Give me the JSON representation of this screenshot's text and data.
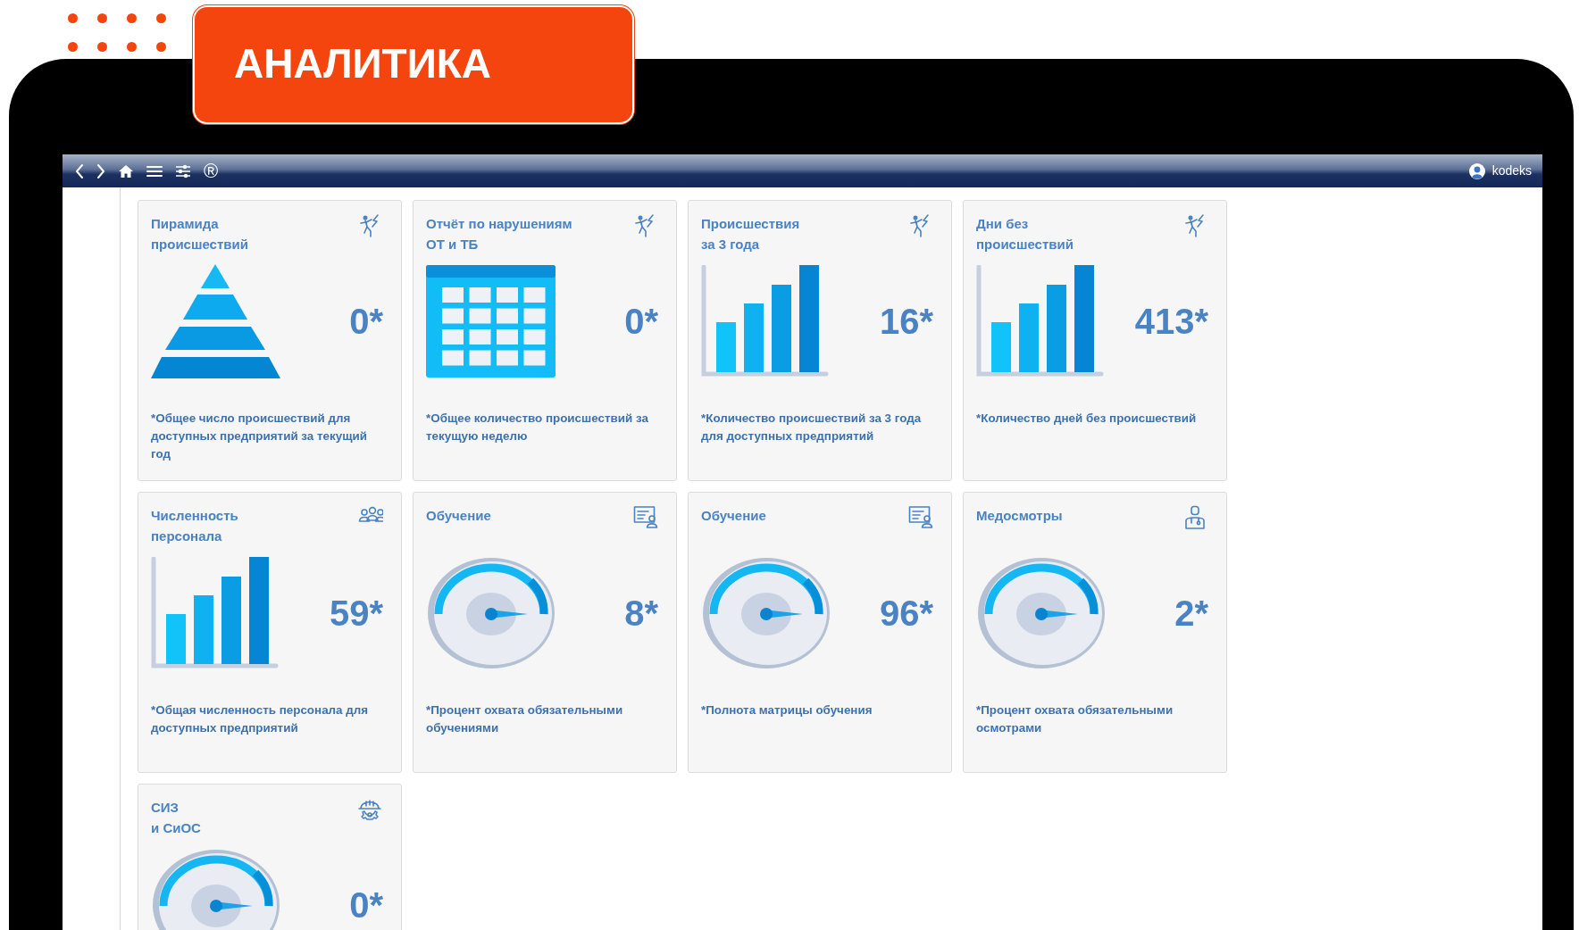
{
  "header": {
    "badge": "АНАЛИТИКА"
  },
  "toolbar": {
    "registered_mark": "®",
    "user": "kodeks"
  },
  "tiles": [
    {
      "kind": "pyramid",
      "title_lines": [
        "Пирамида",
        "происшествий"
      ],
      "value": "0*",
      "description": "*Общее число происшествий для доступных предприятий за текущий год"
    },
    {
      "kind": "grid",
      "title_lines": [
        "Отчёт по нарушениям",
        "ОТ и ТБ"
      ],
      "value": "0*",
      "description": "*Общее количество происшествий за текущую неделю"
    },
    {
      "kind": "bars",
      "title_lines": [
        "Происшествия",
        "за 3 года"
      ],
      "value": "16*",
      "description": "*Количество происшествий за 3 года для доступных предприятий"
    },
    {
      "kind": "bars",
      "title_lines": [
        "Дни без",
        "происшествий"
      ],
      "value": "413*",
      "description": "*Количество дней без происшествий"
    },
    {
      "kind": "bars",
      "title_lines": [
        "Численность",
        "персонала"
      ],
      "value": "59*",
      "description": "*Общая численность персонала для доступных предприятий"
    },
    {
      "kind": "gauge",
      "title_lines": [
        "Обучение"
      ],
      "value": "8*",
      "description": "*Процент охвата обязательными обучениями"
    },
    {
      "kind": "gauge",
      "title_lines": [
        "Обучение"
      ],
      "value": "96*",
      "description": "*Полнота матрицы обучения"
    },
    {
      "kind": "gauge",
      "title_lines": [
        "Медосмотры"
      ],
      "value": "2*",
      "description": "*Процент охвата обязательными осмотрами"
    },
    {
      "kind": "gauge",
      "title_lines": [
        "СИЗ",
        "и СиОС"
      ],
      "value": "0*"
    }
  ]
}
